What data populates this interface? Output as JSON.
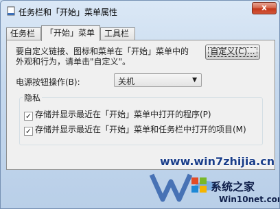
{
  "window": {
    "title": "任务栏和「开始」菜单属性",
    "close_symbol": "x"
  },
  "tabs": [
    {
      "label": "任务栏",
      "active": false
    },
    {
      "label": "「开始」菜单",
      "active": true
    },
    {
      "label": "工具栏",
      "active": false
    }
  ],
  "start_menu": {
    "description_line1": "要自定义链接、图标和菜单在「开始」菜单中的",
    "description_line2": "外观和行为，请单击\"自定义\"。",
    "customize_button": "自定义(C)...",
    "power_button_label": "电源按钮操作(B):",
    "power_button_value": "关机",
    "dropdown_arrow": "▼"
  },
  "privacy": {
    "title": "隐私",
    "options": [
      {
        "label": "存储并显示最近在「开始」菜单中打开的程序(P)",
        "checked": true
      },
      {
        "label": "存储并显示最近在「开始」菜单和任务栏中打开的项目(M)",
        "checked": true
      }
    ],
    "check_mark": "✓"
  },
  "watermark": {
    "url_main": "www.win7zhijia.cn",
    "logo_name": "系统之家",
    "logo_url": "Win10net.com"
  },
  "colors": {
    "accent": "#1a3e8a",
    "close_red": "#c4391c"
  }
}
